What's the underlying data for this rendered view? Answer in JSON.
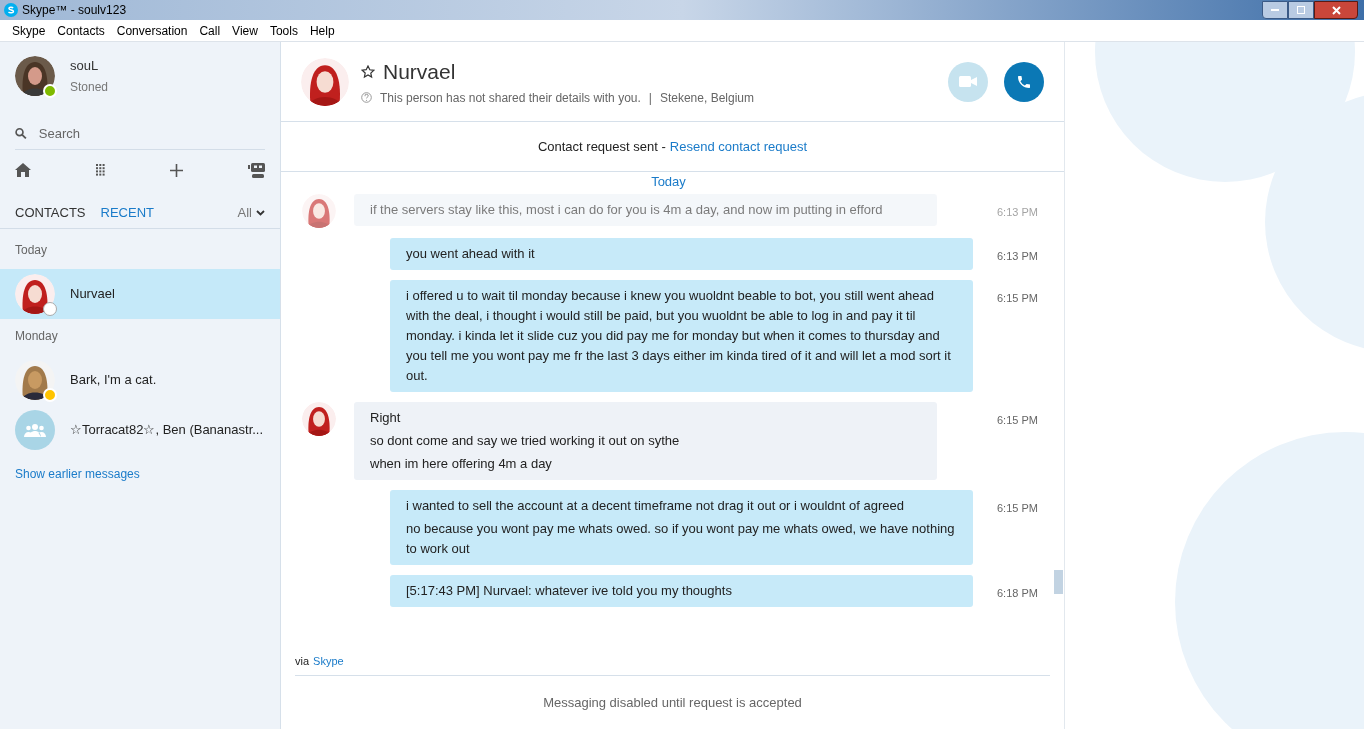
{
  "window": {
    "title": "Skype™ - soulv123"
  },
  "menu": [
    "Skype",
    "Contacts",
    "Conversation",
    "Call",
    "View",
    "Tools",
    "Help"
  ],
  "profile": {
    "name": "souL",
    "mood": "Stoned"
  },
  "search": {
    "placeholder": "Search"
  },
  "list_tabs": [
    {
      "label": "CONTACTS",
      "selected": false
    },
    {
      "label": "RECENT",
      "selected": true
    }
  ],
  "filter": "All",
  "groups": [
    {
      "label": "Today",
      "items": [
        {
          "name": "Nurvael",
          "kind": "person",
          "pending": true,
          "away": false,
          "selected": true
        }
      ]
    },
    {
      "label": "Monday",
      "items": [
        {
          "name": "Bark, I'm a cat.",
          "kind": "person",
          "pending": false,
          "away": true,
          "selected": false
        },
        {
          "name": "☆Torracat82☆, Ben (Bananastr...",
          "kind": "group",
          "pending": false,
          "away": false,
          "selected": false
        }
      ]
    }
  ],
  "show_earlier": "Show earlier messages",
  "contact": {
    "name": "Nurvael",
    "details": "This person has not shared their details with you.",
    "separator": "|",
    "location": "Stekene, Belgium"
  },
  "request": {
    "text": "Contact request sent -",
    "link": "Resend contact request"
  },
  "day": "Today",
  "messages": [
    {
      "kind": "incoming",
      "faded": true,
      "lines": [
        "if the servers stay like this, most i can do for you is 4m a day, and now im putting in efford"
      ],
      "time": "6:13 PM"
    },
    {
      "kind": "outgoing",
      "faded": false,
      "lines": [
        "you went ahead with it"
      ],
      "time": "6:13 PM"
    },
    {
      "kind": "outgoing",
      "faded": false,
      "lines": [
        "i offered u to wait til monday because i knew you wuoldnt beable to bot, you still went ahead with the deal, i thought i would still be paid, but you wuoldnt be able to log in and pay it til monday. i kinda let it slide cuz you did pay me for monday but when it comes to thursday and you tell me you wont pay me fr the last 3 days either im kinda tired of it and will let a mod sort it out."
      ],
      "time": "6:15 PM"
    },
    {
      "kind": "incoming",
      "faded": false,
      "lines": [
        "Right",
        "so dont come and say we tried working it out on sythe",
        "when im here offering 4m a day"
      ],
      "time": "6:15 PM"
    },
    {
      "kind": "outgoing",
      "faded": false,
      "lines": [
        "i wanted to sell the account at a decent timeframe not drag it out or i wouldnt of agreed",
        "no because you wont pay me whats owed. so if you wont pay me whats owed, we have nothing to work out"
      ],
      "time": "6:15 PM"
    },
    {
      "kind": "outgoing",
      "faded": false,
      "lines": [
        "[5:17:43 PM] Nurvael: whatever ive told you my thoughts"
      ],
      "time": "6:18 PM"
    }
  ],
  "via": {
    "text": "via",
    "link": "Skype"
  },
  "composer": "Messaging disabled until request is accepted"
}
